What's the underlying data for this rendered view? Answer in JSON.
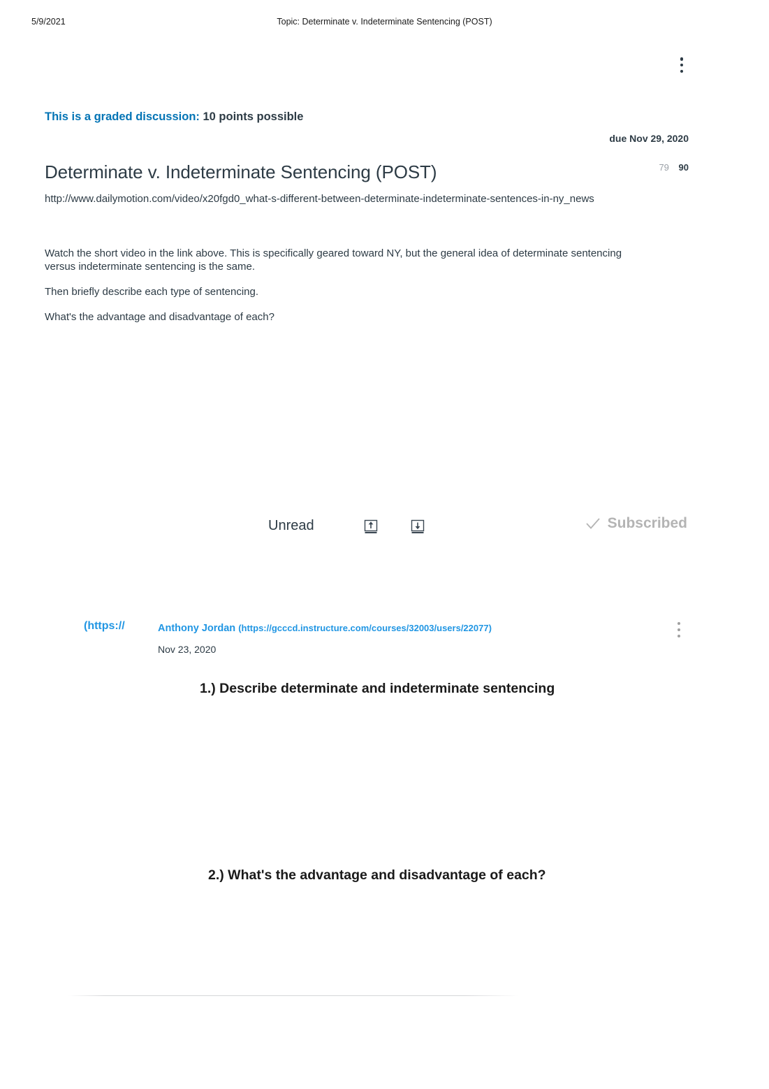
{
  "print_header": {
    "date": "5/9/2021",
    "title": "Topic: Determinate v. Indeterminate Sentencing (POST)"
  },
  "topic": {
    "graded_label": "This is a graded discussion:",
    "points_possible": "10 points possible",
    "due": "due Nov 29, 2020",
    "title": "Determinate v. Indeterminate Sentencing (POST)",
    "unread_count": "79",
    "total_count": "90",
    "link_url": "http://www.dailymotion.com/video/x20fgd0_what-s-different-between-determinate-indeterminate-sentences-in-ny_news",
    "paragraphs": [
      "Watch the short video in the link above.  This is specifically geared toward NY, but the general idea of determinate sentencing versus indeterminate sentencing is the same.",
      "Then briefly describe each type of sentencing.",
      "What's the advantage and disadvantage of each?"
    ]
  },
  "toolbar": {
    "unread_label": "Unread",
    "mark_all_read_icon": "tray-up-arrow-icon",
    "mark_all_unread_icon": "tray-down-arrow-icon",
    "subscribed_label": "Subscribed",
    "subscribed_icon": "check-icon"
  },
  "reply": {
    "avatar_link_text": "(https://",
    "author_name": "Anthony Jordan",
    "author_url": "(https://gcccd.instructure.com/courses/32003/users/22077)",
    "date": "Nov 23, 2020",
    "headings": [
      "1.) Describe determinate and indeterminate sentencing",
      "2.) What's the advantage and disadvantage of each?"
    ]
  },
  "colors": {
    "brand_blue": "#0374B5",
    "link_blue": "#2196e3",
    "text_dark": "#2D3B45",
    "muted_gray": "#b4b4b4"
  }
}
